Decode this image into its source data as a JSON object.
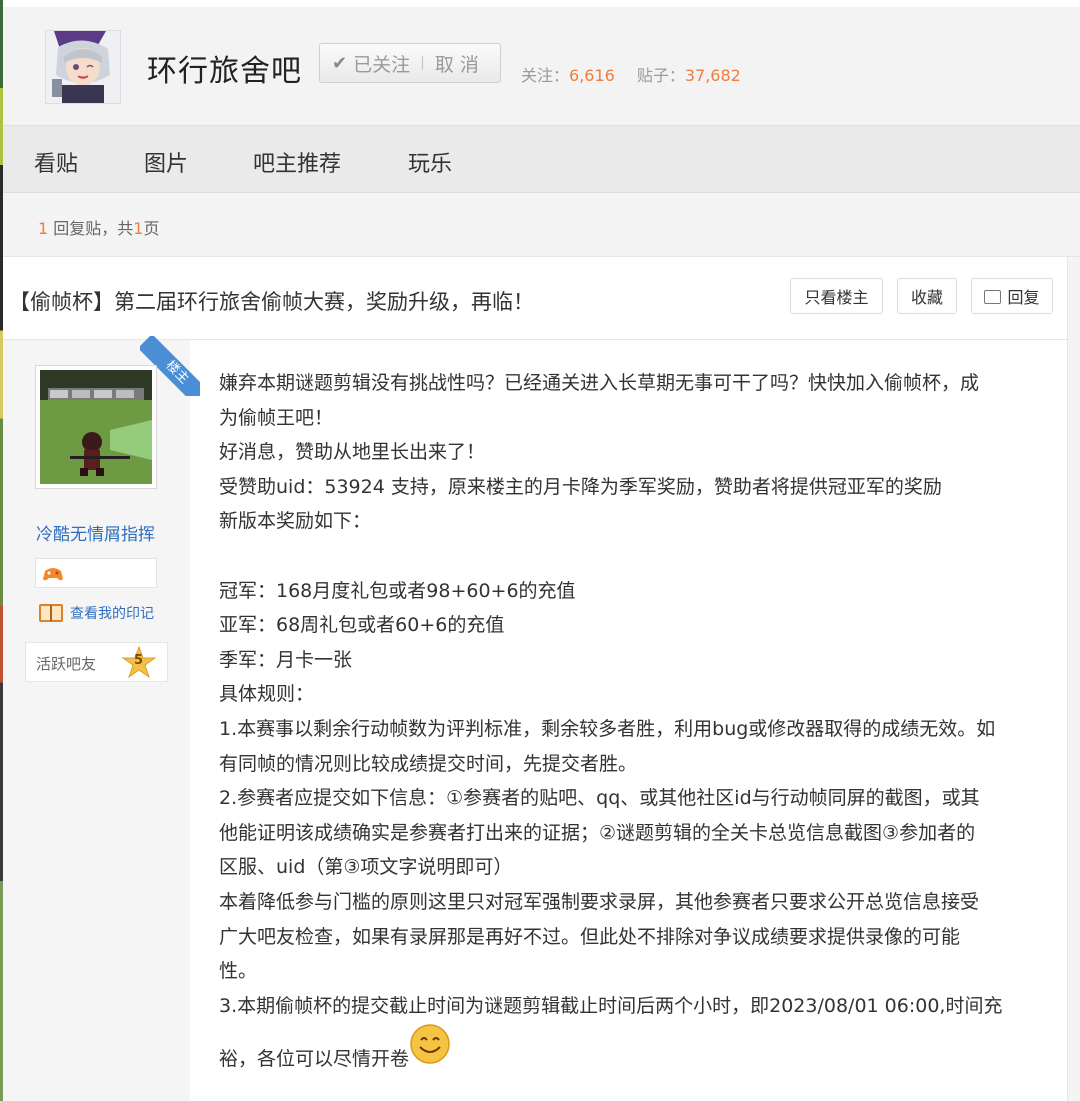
{
  "forum": {
    "name": "环行旅舍吧",
    "follow_label": "已关注",
    "unfollow_label": "取 消",
    "followers_label": "关注：",
    "followers": "6,616",
    "posts_label": "贴子：",
    "posts": "37,682"
  },
  "nav": {
    "items": [
      "看贴",
      "图片",
      "吧主推荐",
      "玩乐"
    ]
  },
  "reply_info": {
    "count": "1",
    "text_a": "回复贴，共",
    "pages": "1",
    "text_b": "页"
  },
  "post": {
    "title": "【偷帧杯】第二届环行旅舍偷帧大赛，奖励升级，再临！",
    "buttons": {
      "only_op": "只看楼主",
      "favorite": "收藏",
      "reply": "回复"
    },
    "lz_label": "楼主",
    "author": {
      "name": "冷酷无情屑指挥",
      "imprint_label": "查看我的印记",
      "level_title": "活跃吧友",
      "level": "5"
    },
    "lines": [
      "嫌弃本期谜题剪辑没有挑战性吗？已经通关进入长草期无事可干了吗？快快加入偷帧杯，成",
      "为偷帧王吧！",
      "好消息，赞助从地里长出来了！",
      "受赞助uid：53924 支持，原来楼主的月卡降为季军奖励，赞助者将提供冠亚军的奖励",
      "新版本奖励如下：",
      "",
      "冠军：168月度礼包或者98+60+6的充值",
      "亚军：68周礼包或者60+6的充值",
      "季军：月卡一张",
      "具体规则：",
      "1.本赛事以剩余行动帧数为评判标准，剩余较多者胜，利用bug或修改器取得的成绩无效。如",
      "有同帧的情况则比较成绩提交时间，先提交者胜。",
      "2.参赛者应提交如下信息：①参赛者的贴吧、qq、或其他社区id与行动帧同屏的截图，或其",
      "他能证明该成绩确实是参赛者打出来的证据；②谜题剪辑的全关卡总览信息截图③参加者的",
      "区服、uid（第③项文字说明即可）",
      "本着降低参与门槛的原则这里只对冠军强制要求录屏，其他参赛者只要求公开总览信息接受",
      "广大吧友检查，如果有录屏那是再好不过。但此处不排除对争议成绩要求提供录像的可能",
      "性。",
      "3.本期偷帧杯的提交截止时间为谜题剪辑截止时间后两个小时，即2023/08/01 06:00,时间充",
      "裕，各位可以尽情开卷"
    ]
  },
  "colors": {
    "accent_orange": "#f07c3e",
    "link_blue": "#2f6fbf",
    "ribbon_blue": "#4a8fd6"
  }
}
